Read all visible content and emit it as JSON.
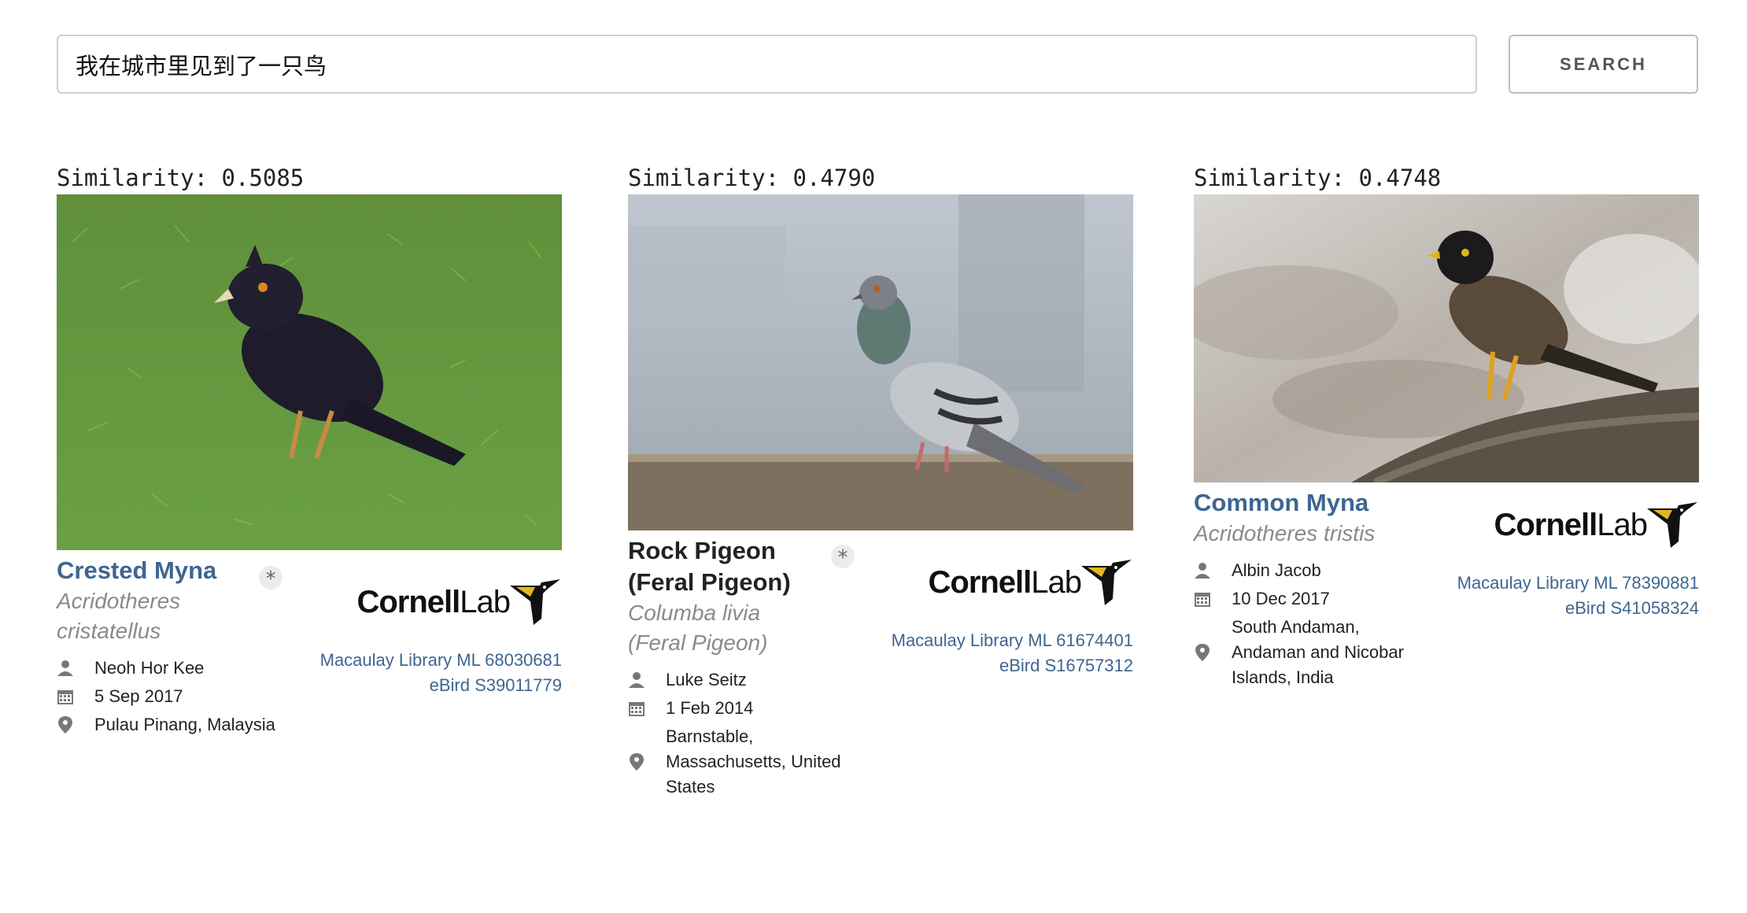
{
  "search": {
    "value": "我在城市里见到了一只鸟",
    "button_label": "SEARCH"
  },
  "results": [
    {
      "similarity": "Similarity: 0.5085",
      "common_name": "Crested Myna",
      "sci_name_1": "Acridotheres",
      "sci_name_2": "cristatellus",
      "photographer": "Neoh Hor Kee",
      "date": "5 Sep 2017",
      "location_1": "Pulau Pinang, Malaysia",
      "logo_bold": "Cornell",
      "logo_light": "Lab",
      "ml_id": "Macaulay Library ML 68030681",
      "ebird_id": "eBird S39011779"
    },
    {
      "similarity": "Similarity: 0.4790",
      "common_name_1": "Rock Pigeon",
      "common_name_2": "(Feral Pigeon)",
      "sci_name_1": "Columba livia",
      "sci_name_2": "(Feral Pigeon)",
      "photographer": "Luke Seitz",
      "date": "1 Feb 2014",
      "location_1": "Barnstable,",
      "location_2": "Massachusetts, United",
      "location_3": "States",
      "logo_bold": "Cornell",
      "logo_light": "Lab",
      "ml_id": "Macaulay Library ML 61674401",
      "ebird_id": "eBird S16757312"
    },
    {
      "similarity": "Similarity: 0.4748",
      "common_name": "Common Myna",
      "sci_name_1": "Acridotheres tristis",
      "photographer": "Albin Jacob",
      "date": "10 Dec 2017",
      "location_1": "South Andaman,",
      "location_2": "Andaman and Nicobar",
      "location_3": "Islands, India",
      "logo_bold": "Cornell",
      "logo_light": "Lab",
      "ml_id": "Macaulay Library ML 78390881",
      "ebird_id": "eBird S41058324"
    }
  ],
  "icons": {
    "person": "person-icon",
    "calendar": "calendar-icon",
    "location": "location-pin-icon",
    "star": "asterisk-icon"
  },
  "colors": {
    "link": "#3e6690",
    "muted": "#8a8a8a"
  }
}
